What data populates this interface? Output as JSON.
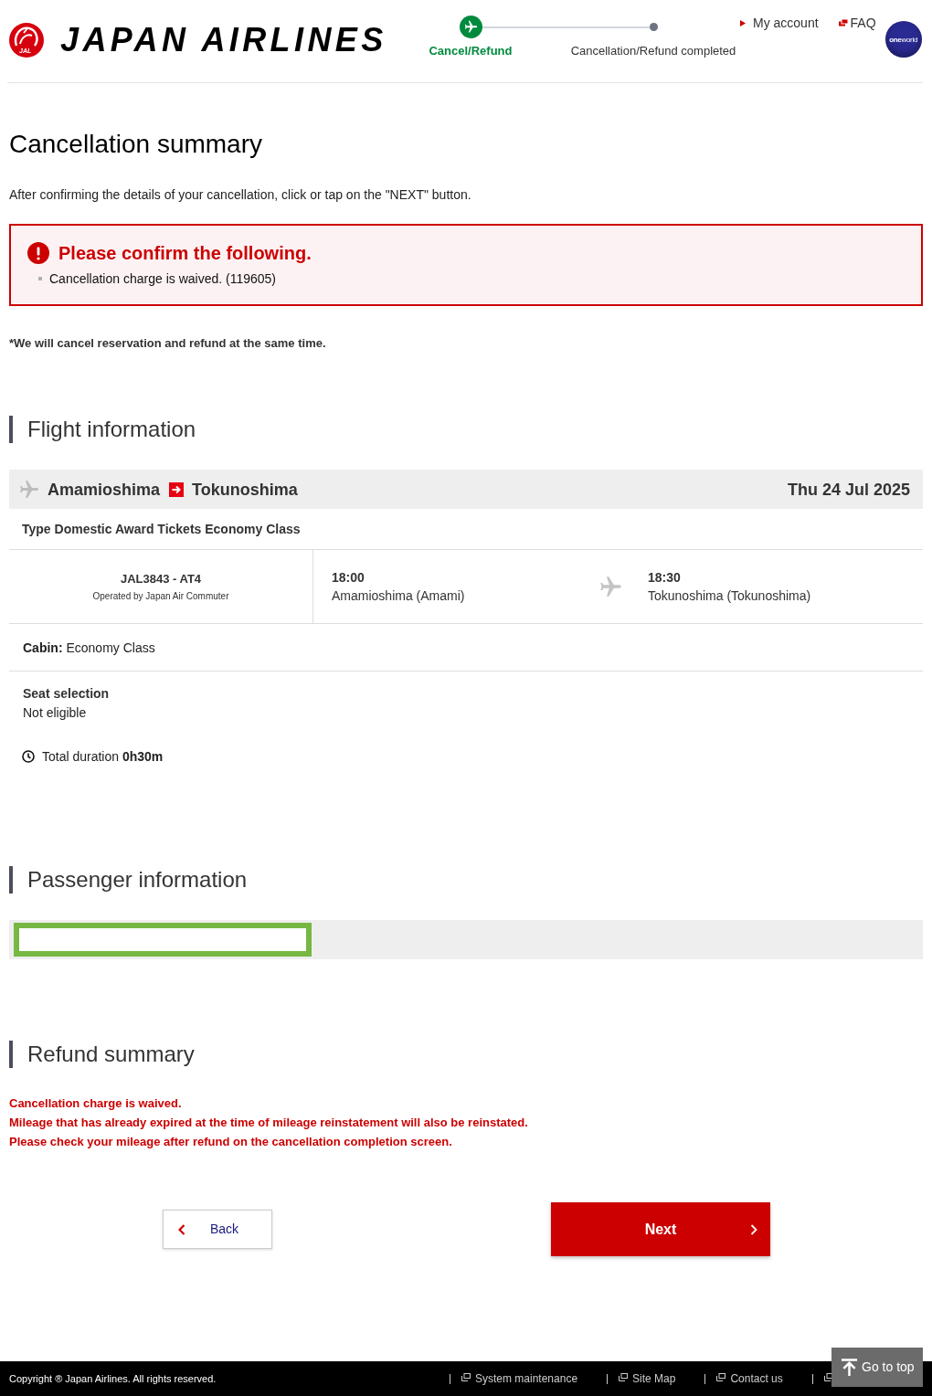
{
  "header": {
    "logo_mark": "JAL",
    "brand_name": "JAPAN AIRLINES",
    "steps": [
      {
        "label": "Cancel/Refund",
        "selected": true
      },
      {
        "label": "Cancellation/Refund completed",
        "selected": false
      }
    ],
    "links": [
      {
        "kind": "account",
        "label": "My account"
      },
      {
        "kind": "faq",
        "label": "FAQ"
      }
    ],
    "alliance_logo": "**one**world"
  },
  "page_title": "Cancellation summary",
  "intro": "After confirming the details of your cancellation, click or tap on the \"NEXT\" button.",
  "alert": {
    "title": "Please confirm the following.",
    "items": [
      "Cancellation charge is waived. (119605)"
    ]
  },
  "note": "*We will cancel reservation and refund at the same time.",
  "flight_information": {
    "heading": "Flight information",
    "origin": "Amamioshima",
    "destination": "Tokunoshima",
    "date": "Thu 24 Jul 2025",
    "fare_type": "Type Domestic Award Tickets Economy Class",
    "segment": {
      "flight": "JAL3843 - AT4",
      "operator": "Operated by Japan Air Commuter",
      "departure_time": "18:00",
      "departure_airport": "Amamioshima (Amami)",
      "arrival_time": "18:30",
      "arrival_airport": "Tokunoshima (Tokunoshima)"
    },
    "cabin": "**Cabin:** Economy Class",
    "seat_selection": {
      "label": "Seat selection",
      "value": "Not eligible"
    },
    "total_duration": "Total duration **0h30m**"
  },
  "passenger_information": {
    "heading": "Passenger information",
    "passengers": [
      {
        "selected": true
      }
    ]
  },
  "refund_summary": {
    "heading": "Refund summary",
    "messages": [
      "Cancellation charge is waived.",
      "Mileage that has already expired at the time of mileage reinstatement will also be reinstated.",
      "Please check your mileage after refund on the cancellation completion screen."
    ]
  },
  "buttons": {
    "back": "Back",
    "next": "Next"
  },
  "footer": {
    "copyright": "Copyright ® Japan Airlines. All rights reserved.",
    "links": [
      {
        "kind": "link",
        "label": "System maintenance"
      },
      {
        "kind": "link",
        "label": "Site Map"
      },
      {
        "kind": "link",
        "label": "Contact us"
      },
      {
        "kind": "covered"
      }
    ],
    "go_to_top": "Go to top"
  }
}
